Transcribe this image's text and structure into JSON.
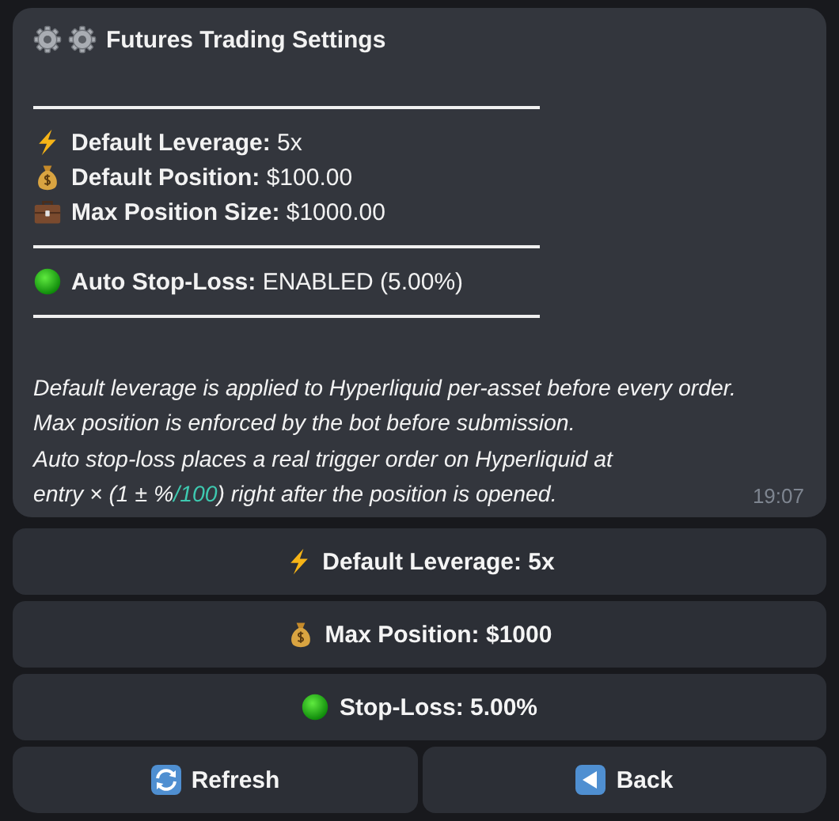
{
  "message": {
    "title": {
      "icons": [
        {
          "kind": "gear"
        },
        {
          "kind": "gear"
        }
      ],
      "text": "Futures Trading Settings"
    },
    "sections": [
      {
        "rows": [
          {
            "kind": "bolt",
            "label": "Default Leverage:",
            "value": "5x"
          },
          {
            "kind": "moneybag",
            "label": "Default Position:",
            "value": "$100.00"
          },
          {
            "kind": "briefcase",
            "label": "Max Position Size:",
            "value": "$1000.00"
          }
        ]
      },
      {
        "rows": [
          {
            "kind": "dot",
            "label": "Auto Stop-Loss:",
            "value": "ENABLED (5.00%)"
          }
        ]
      }
    ],
    "note": [
      [
        {
          "kind": "text",
          "text": "Default leverage is applied to Hyperliquid per-asset before every order."
        }
      ],
      [
        {
          "kind": "text",
          "text": "Max position is enforced by the bot before submission."
        }
      ],
      [
        {
          "kind": "text",
          "text": "Auto stop-loss places a real trigger order on Hyperliquid at"
        }
      ],
      [
        {
          "kind": "text",
          "text": "entry × (1 ± %"
        },
        {
          "kind": "command",
          "text": "/100"
        },
        {
          "kind": "text",
          "text": ") right after the position is opened."
        }
      ]
    ],
    "time": "19:07"
  },
  "keyboard": [
    [
      {
        "kind": "bolt",
        "label": "Default Leverage: 5x"
      }
    ],
    [
      {
        "kind": "moneybag",
        "label": "Max Position: $1000"
      }
    ],
    [
      {
        "kind": "dot",
        "label": "Stop-Loss: 5.00%"
      }
    ],
    [
      {
        "kind": "refresh",
        "label": "Refresh"
      },
      {
        "kind": "back",
        "label": "Back"
      }
    ]
  ]
}
